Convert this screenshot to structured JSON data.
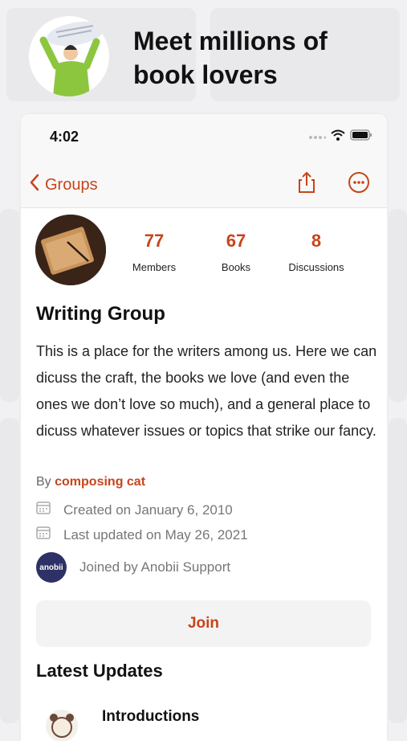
{
  "promo": {
    "headline": "Meet millions of book lovers"
  },
  "status_bar": {
    "time": "4:02"
  },
  "nav": {
    "back_label": "Groups"
  },
  "group": {
    "stats": [
      {
        "value": "77",
        "label": "Members"
      },
      {
        "value": "67",
        "label": "Books"
      },
      {
        "value": "8",
        "label": "Discussions"
      }
    ],
    "title": "Writing Group",
    "description": "This is a place for the writers among us. Here we can dicuss the craft, the books we love (and even the ones we don’t love so much), and a general place to dicuss whatever issues or topics that strike our fancy.",
    "by_prefix": "By",
    "author": "composing cat",
    "created": "Created on January 6, 2010",
    "updated": "Last updated on May 26, 2021",
    "joined_logo_text": "anobii",
    "joined": "Joined by Anobii Support",
    "join_label": "Join"
  },
  "latest": {
    "title": "Latest Updates",
    "items": [
      {
        "title": "Introductions"
      }
    ]
  },
  "colors": {
    "accent": "#c8441b",
    "logo_bg": "#2e3165"
  }
}
